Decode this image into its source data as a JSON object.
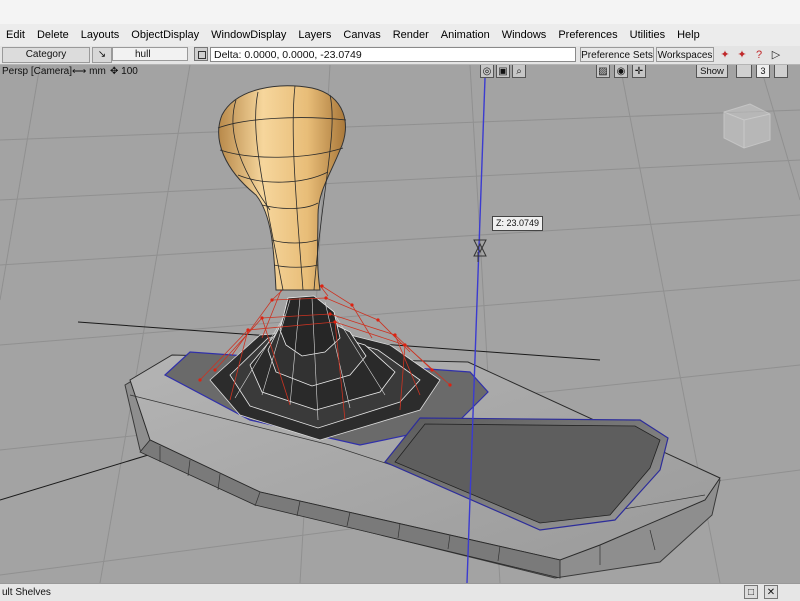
{
  "menu": [
    "Edit",
    "Delete",
    "Layouts",
    "ObjectDisplay",
    "WindowDisplay",
    "Layers",
    "Canvas",
    "Render",
    "Animation",
    "Windows",
    "Preferences",
    "Utilities",
    "Help"
  ],
  "toolbar": {
    "category": "Category",
    "tool_name": "hull",
    "delta": "Delta:  0.0000, 0.0000, -23.0749",
    "preference_sets": "Preference Sets",
    "workspaces": "Workspaces"
  },
  "viewport": {
    "title": "Persp [Camera]",
    "units": "mm",
    "zoom": "100",
    "show_button": "Show",
    "layout_number": "3",
    "z_readout": "Z: 23.0749"
  },
  "status": {
    "shelves_label": "ult Shelves"
  },
  "colors": {
    "knob": "#e8c080",
    "grid": "#8f8f8f",
    "base_surface": "#a8a8a8",
    "cv_hull": "#cc3322",
    "manipulator": "#4a4acc"
  },
  "icons": [
    "pick-icon",
    "tumble-icon",
    "camera-icon",
    "zoom-icon",
    "fit-icon",
    "grid-icon",
    "move-icon",
    "view-cube-icon"
  ]
}
